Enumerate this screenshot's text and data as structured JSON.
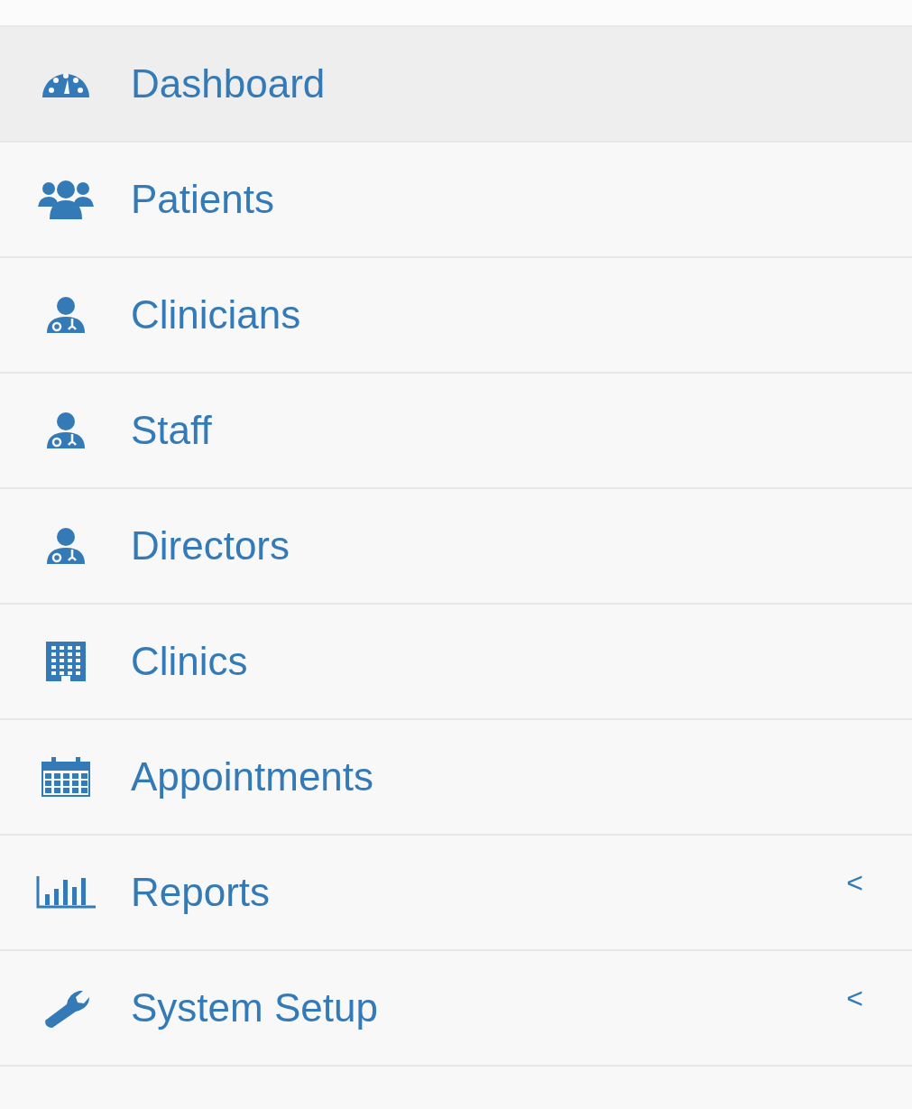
{
  "sidebar": {
    "items": [
      {
        "label": "Dashboard",
        "selected": true,
        "expandable": false
      },
      {
        "label": "Patients",
        "selected": false,
        "expandable": false
      },
      {
        "label": "Clinicians",
        "selected": false,
        "expandable": false
      },
      {
        "label": "Staff",
        "selected": false,
        "expandable": false
      },
      {
        "label": "Directors",
        "selected": false,
        "expandable": false
      },
      {
        "label": "Clinics",
        "selected": false,
        "expandable": false
      },
      {
        "label": "Appointments",
        "selected": false,
        "expandable": false
      },
      {
        "label": "Reports",
        "selected": false,
        "expandable": true
      },
      {
        "label": "System Setup",
        "selected": false,
        "expandable": true
      }
    ],
    "chevron": "<"
  }
}
